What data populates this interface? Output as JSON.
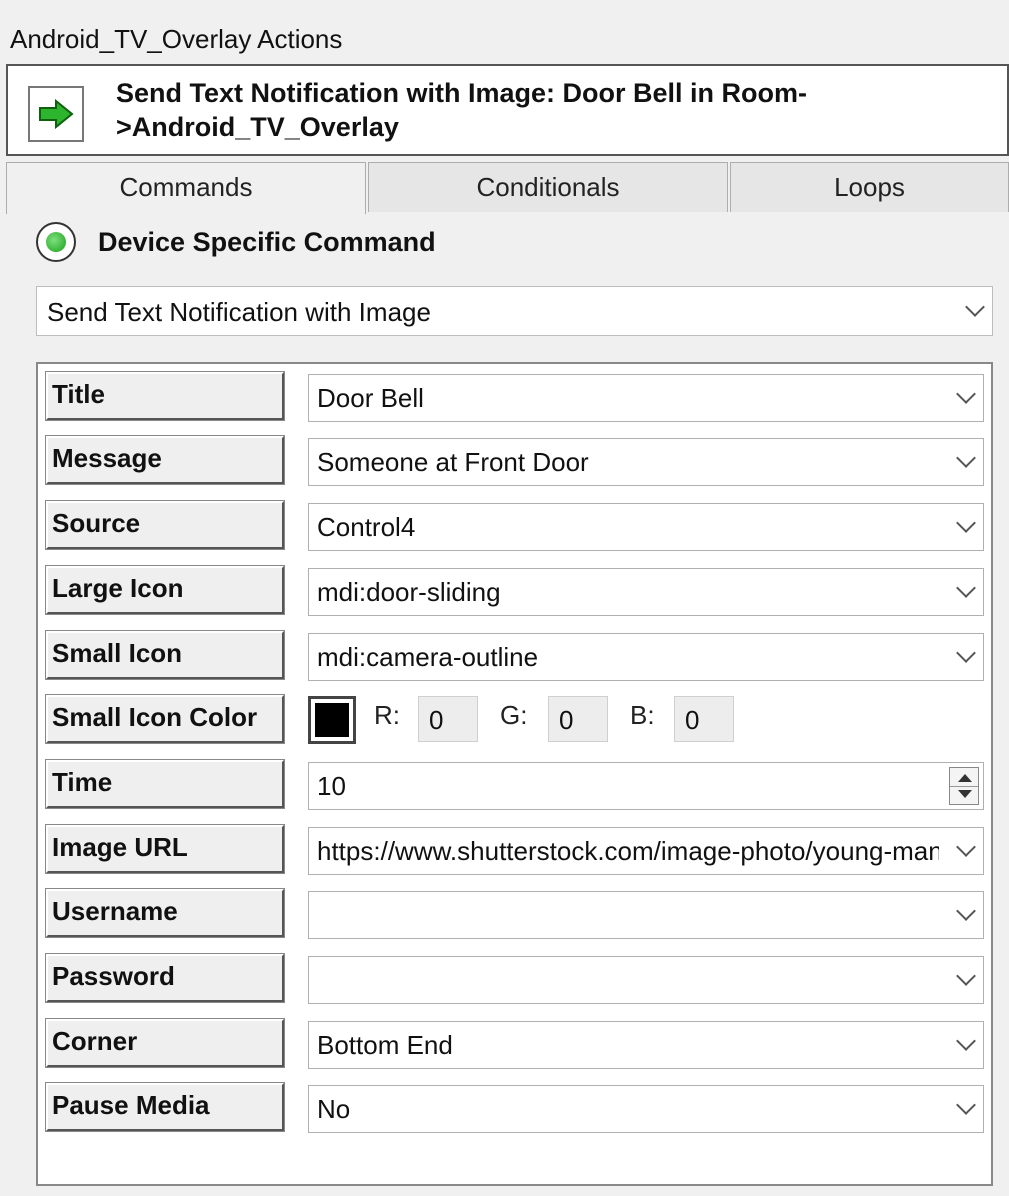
{
  "window": {
    "title": "Android_TV_Overlay Actions"
  },
  "header": {
    "title": "Send Text Notification with Image:  Door Bell in Room->Android_TV_Overlay"
  },
  "tabs": [
    {
      "label": "Commands",
      "active": true
    },
    {
      "label": "Conditionals",
      "active": false
    },
    {
      "label": "Loops",
      "active": false
    }
  ],
  "command_type": {
    "label": "Device Specific Command",
    "selected": true
  },
  "command": {
    "value": "Send Text Notification with Image"
  },
  "params": {
    "title": {
      "label": "Title",
      "value": "Door Bell"
    },
    "message": {
      "label": "Message",
      "value": "Someone at Front Door"
    },
    "source": {
      "label": "Source",
      "value": "Control4"
    },
    "large_icon": {
      "label": "Large Icon",
      "value": "mdi:door-sliding"
    },
    "small_icon": {
      "label": "Small Icon",
      "value": "mdi:camera-outline"
    },
    "small_icon_color": {
      "label": "Small Icon Color",
      "swatch": "#000000",
      "r_label": "R:",
      "r": "0",
      "g_label": "G:",
      "g": "0",
      "b_label": "B:",
      "b": "0"
    },
    "time": {
      "label": "Time",
      "value": "10"
    },
    "image_url": {
      "label": "Image URL",
      "value": "https://www.shutterstock.com/image-photo/young-man"
    },
    "username": {
      "label": "Username",
      "value": ""
    },
    "password": {
      "label": "Password",
      "value": ""
    },
    "corner": {
      "label": "Corner",
      "value": "Bottom End"
    },
    "pause_media": {
      "label": "Pause Media",
      "value": "No"
    }
  },
  "colors": {
    "accent_green": "#22a822",
    "panel_bg": "#f0f0f0"
  },
  "icons": {
    "header": "green-arrow-right-icon",
    "dropdown": "chevron-down-icon"
  }
}
